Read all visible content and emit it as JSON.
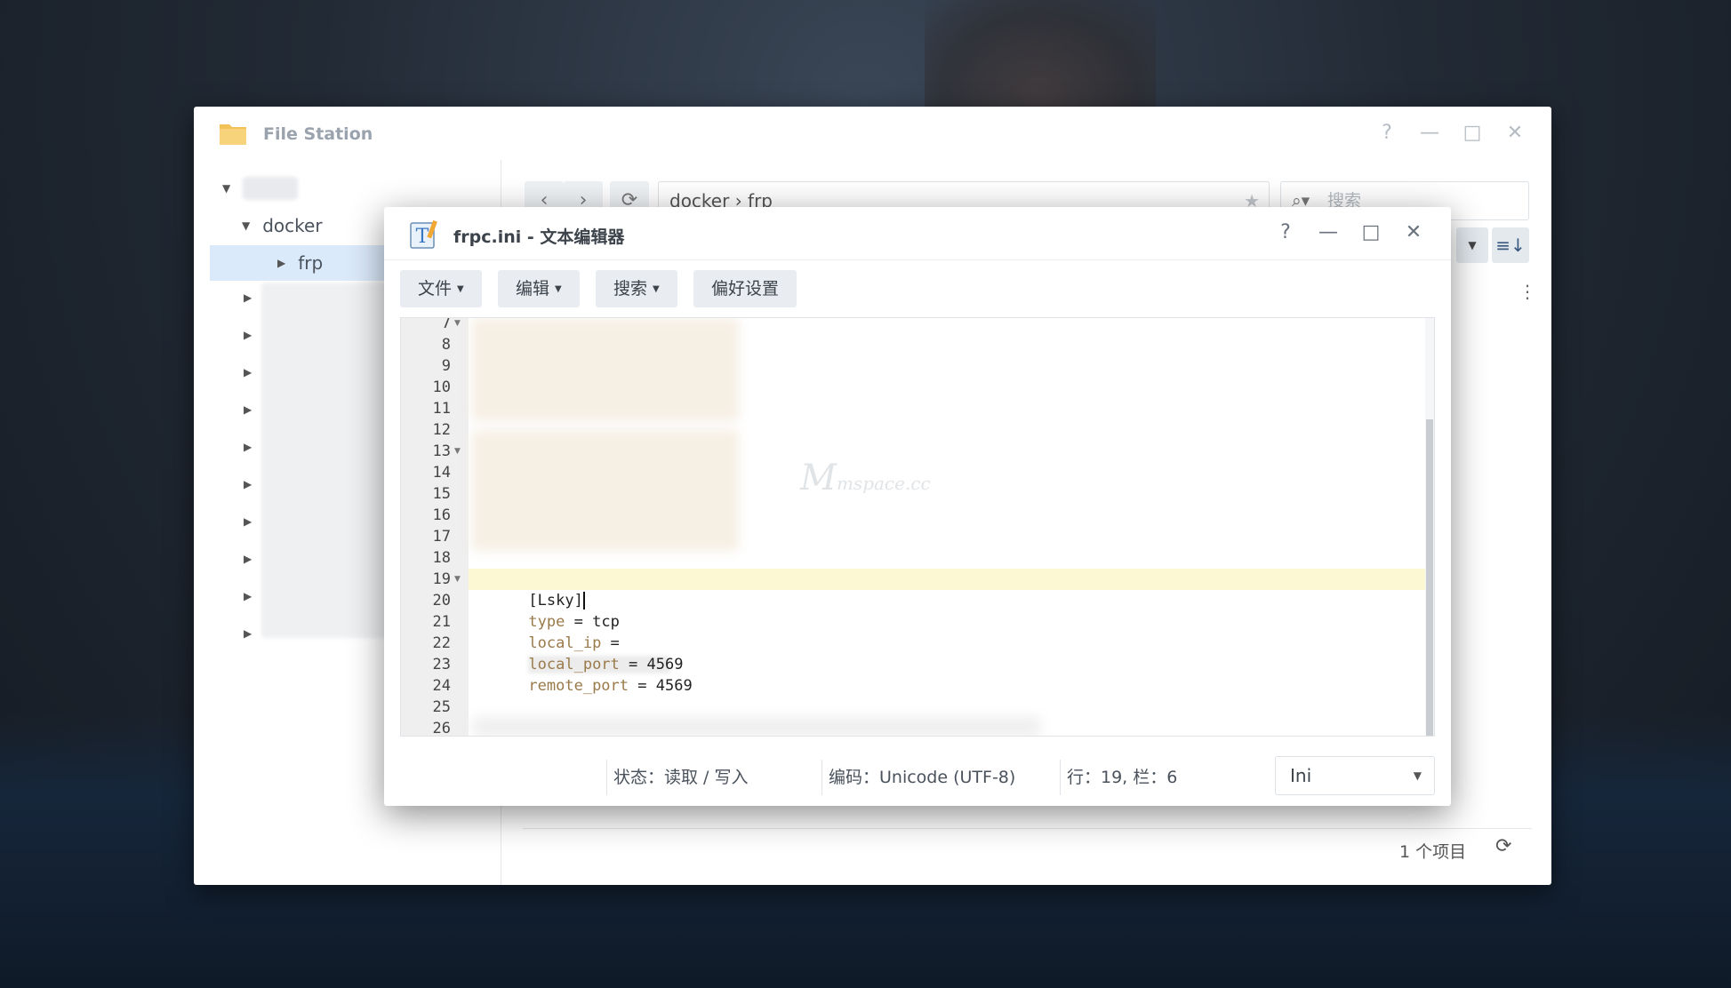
{
  "file_station": {
    "title": "File Station",
    "controls": {
      "help": "?",
      "minimize": "—",
      "maximize": "□",
      "close": "✕"
    },
    "tree": {
      "docker_label": "docker",
      "frp_label": "frp"
    },
    "path": {
      "segment1": "docker",
      "separator": "›",
      "segment2": "frp"
    },
    "search_placeholder": "搜索",
    "footer_count": "1 个项目"
  },
  "editor": {
    "title": "frpc.ini - 文本编辑器",
    "controls": {
      "help": "?",
      "minimize": "—",
      "maximize": "□",
      "close": "✕"
    },
    "menu": {
      "file": "文件",
      "edit": "编辑",
      "search": "搜索",
      "prefs": "偏好设置"
    },
    "line_numbers": [
      "7",
      "8",
      "9",
      "10",
      "11",
      "12",
      "13",
      "14",
      "15",
      "16",
      "17",
      "18",
      "19",
      "20",
      "21",
      "22",
      "23",
      "24",
      "25",
      "26"
    ],
    "code": {
      "line19": "[Lsky]",
      "line20_key": "type",
      "line20_eq": " = ",
      "line20_val": "tcp",
      "line21_key": "local_ip",
      "line21_eq": " = ",
      "line22_key": "local_port",
      "line22_eq": " = ",
      "line22_val": "4569",
      "line23_key": "remote_port",
      "line23_eq": " = ",
      "line23_val": "4569"
    },
    "status": {
      "state": "状态：读取 / 写入",
      "encoding": "编码：Unicode (UTF-8)",
      "position": "行：19, 栏：6",
      "language": "Ini"
    }
  },
  "watermark": {
    "main": "M",
    "sub": "mspace.cc"
  }
}
